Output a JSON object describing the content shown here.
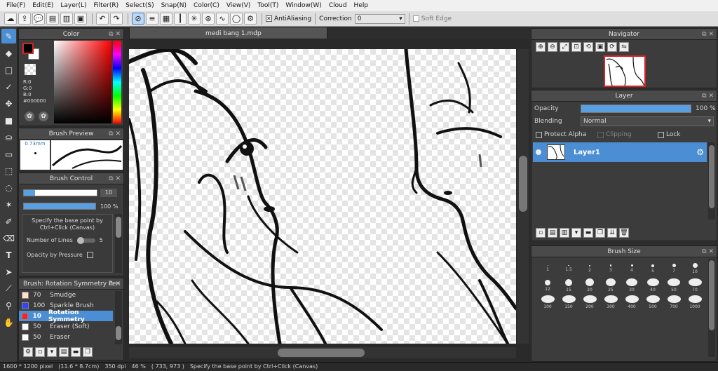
{
  "menu": [
    "File(F)",
    "Edit(E)",
    "Layer(L)",
    "Filter(R)",
    "Select(S)",
    "Snap(N)",
    "Color(C)",
    "View(V)",
    "Tool(T)",
    "Window(W)",
    "Cloud",
    "Help"
  ],
  "toolbar": {
    "antialiasing": "AntiAliasing",
    "correction": "Correction",
    "correction_value": "0",
    "soft_edge": "Soft Edge"
  },
  "doc": {
    "tab": "medi bang 1.mdp"
  },
  "color_panel": {
    "title": "Color",
    "r": "R:0",
    "g": "G:0",
    "b": "B:0",
    "hex": "#000000",
    "fg": "#000000",
    "bg": "#ffffff"
  },
  "brush_preview": {
    "title": "Brush Preview",
    "size": "0.73mm"
  },
  "brush_control": {
    "title": "Brush Control",
    "size_value": "10",
    "opacity_value": "100 %",
    "opacity_fraction": 1.0,
    "size_fraction": 0.15,
    "hint": "Specify the base point by Ctrl+Click (Canvas)",
    "lines_label": "Number of Lines",
    "lines_value": "5",
    "pressure_label": "Opacity by Pressure"
  },
  "brush_list": {
    "title": "Brush: Rotation Symmetry Pen",
    "items": [
      {
        "size": "70",
        "name": "Smudge",
        "color": "#ffe0cc",
        "selected": false
      },
      {
        "size": "100",
        "name": "Sparkle Brush",
        "color": "#3344ff",
        "selected": false
      },
      {
        "size": "10",
        "name": "Rotation Symmetry",
        "color": "#ff2222",
        "selected": true
      },
      {
        "size": "50",
        "name": "Eraser (Soft)",
        "color": "#ffffff",
        "selected": false
      },
      {
        "size": "50",
        "name": "Eraser",
        "color": "#ffffff",
        "selected": false
      }
    ]
  },
  "navigator": {
    "title": "Navigator"
  },
  "layer_panel": {
    "title": "Layer",
    "opacity_label": "Opacity",
    "opacity_value": "100 %",
    "opacity_fraction": 1.0,
    "blending_label": "Blending",
    "blending_value": "Normal",
    "protect_alpha": "Protect Alpha",
    "clipping": "Clipping",
    "lock": "Lock",
    "layers": [
      {
        "name": "Layer1"
      }
    ]
  },
  "brush_size": {
    "title": "Brush Size",
    "row1": [
      "1",
      "1.5",
      "2",
      "3",
      "4",
      "5",
      "7",
      "10"
    ],
    "row2": [
      "12",
      "15",
      "20",
      "25",
      "30",
      "40",
      "50",
      "70"
    ],
    "row3": [
      "100",
      "150",
      "200",
      "300",
      "400",
      "500",
      "700",
      "1000"
    ]
  },
  "status": {
    "dims": "1600 * 1200 pixel",
    "phys": "(11.6 * 8.7cm)",
    "dpi": "350 dpi",
    "zoom": "46 %",
    "coords": "( 733, 973 )",
    "hint": "Specify the base point by Ctrl+Click (Canvas)"
  }
}
